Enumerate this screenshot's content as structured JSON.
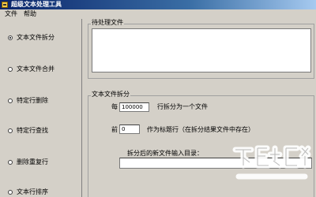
{
  "window": {
    "title": "超级文本处理工具"
  },
  "menu": {
    "file": "文件",
    "help": "帮助"
  },
  "sidebar": {
    "items": [
      {
        "label": "文本文件拆分",
        "selected": true
      },
      {
        "label": "文本文件合并",
        "selected": false
      },
      {
        "label": "特定行删除",
        "selected": false
      },
      {
        "label": "特定行查找",
        "selected": false
      },
      {
        "label": "删除重复行",
        "selected": false
      },
      {
        "label": "文本行排序",
        "selected": false
      }
    ]
  },
  "pending": {
    "group_label": "待处理文件"
  },
  "split": {
    "group_label": "文本文件拆分",
    "every_label": "每",
    "lines_value": "100000",
    "lines_suffix": "行拆分为一个文件",
    "first_label": "前",
    "header_value": "0",
    "header_suffix": "作为标题行（在拆分结果文件中存在）",
    "output_dir_label": "拆分后的新文件输入目录：",
    "output_dir_value": ""
  },
  "colors": {
    "titlebar": "#0a246a",
    "window_bg": "#d4d0c8"
  }
}
